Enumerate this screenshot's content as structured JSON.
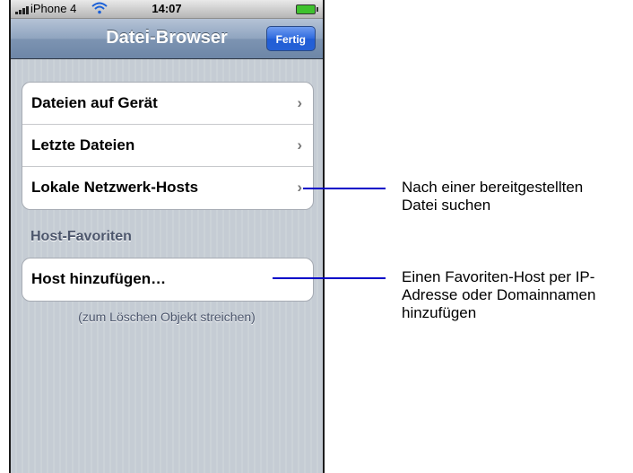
{
  "status_bar": {
    "carrier": "iPhone 4",
    "time": "14:07"
  },
  "nav": {
    "title": "Datei-Browser",
    "done_label": "Fertig"
  },
  "browse_items": [
    {
      "label": "Dateien auf Gerät"
    },
    {
      "label": "Letzte Dateien"
    },
    {
      "label": "Lokale Netzwerk-Hosts"
    }
  ],
  "favorites": {
    "header": "Host-Favoriten",
    "add_host_label": "Host hinzufügen…",
    "note": "(zum Löschen Objekt streichen)"
  },
  "callouts": [
    {
      "line1": "Nach einer bereitgestellten",
      "line2": "Datei suchen"
    },
    {
      "line1": "Einen Favoriten-Host per IP-",
      "line2": "Adresse oder Domainnamen",
      "line3": "hinzufügen"
    }
  ],
  "colors": {
    "callout_line": "#0000c8",
    "nav_button": "#2f6ade",
    "battery": "#3fc22e"
  },
  "icons": {
    "chevron": "chevron-right-icon",
    "wifi": "wifi-icon",
    "signal": "signal-bars-icon",
    "battery": "battery-icon"
  }
}
